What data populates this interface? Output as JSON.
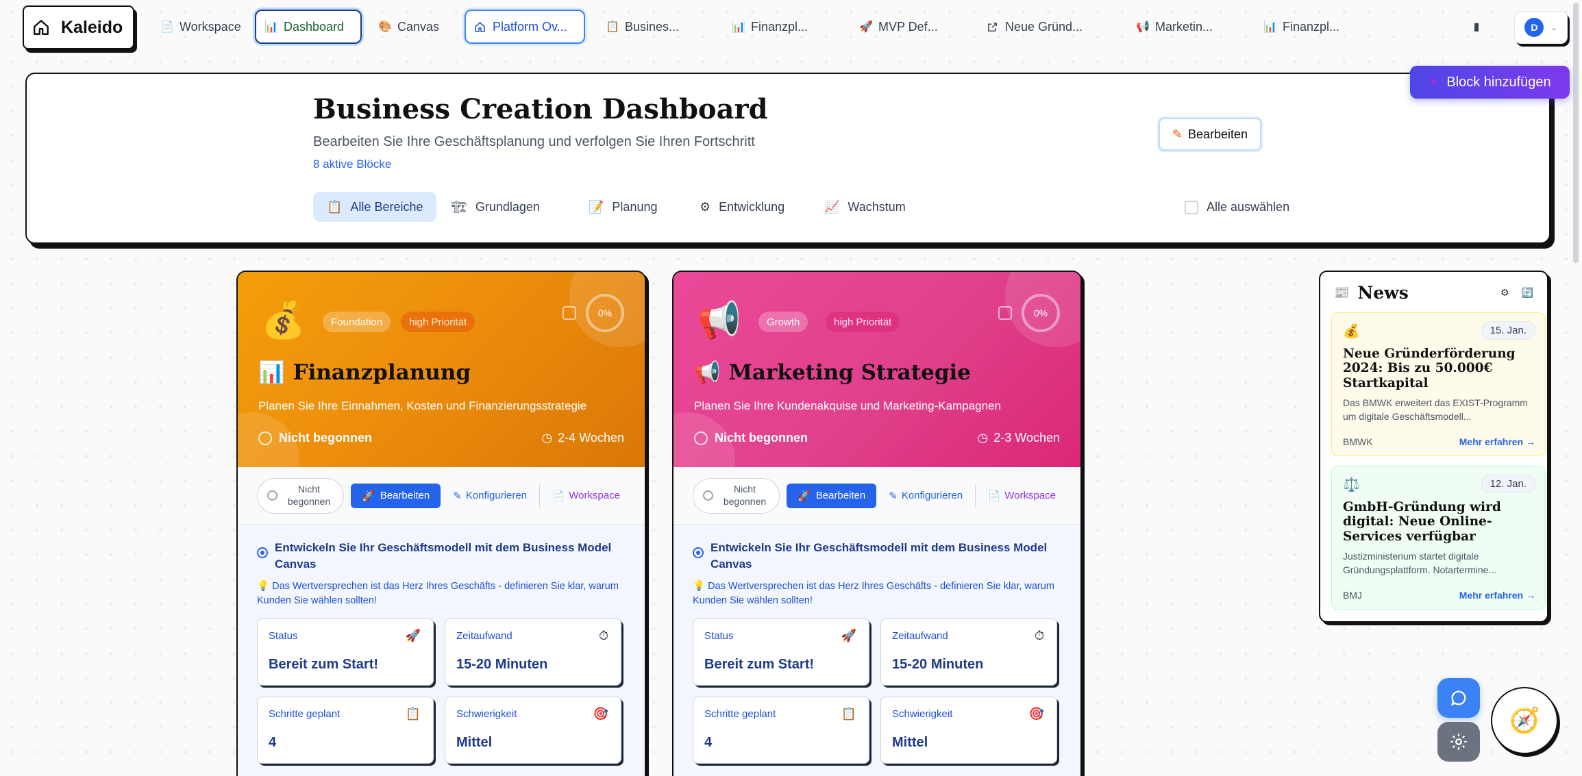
{
  "app": {
    "name": "Kaleido"
  },
  "nav": {
    "tabs": [
      {
        "label": "Workspace",
        "icon": "📄"
      },
      {
        "label": "Dashboard",
        "icon": "📊"
      },
      {
        "label": "Canvas",
        "icon": "🎨"
      },
      {
        "label": "Platform Ov...",
        "icon": "home-icon"
      },
      {
        "label": "Busines...",
        "icon": "📋"
      },
      {
        "label": "Finanzpl...",
        "icon": "📊"
      },
      {
        "label": "MVP Def...",
        "icon": "🚀"
      },
      {
        "label": "Neue Gründ...",
        "icon": "external-link-icon"
      },
      {
        "label": "Marketin...",
        "icon": "📢"
      },
      {
        "label": "Finanzpl...",
        "icon": "📊"
      }
    ],
    "user_initial": "D"
  },
  "header": {
    "title": "Business Creation Dashboard",
    "subtitle": "Bearbeiten Sie Ihre Geschäftsplanung und verfolgen Sie Ihren Fortschritt",
    "block_count": "8 aktive Blöcke",
    "edit_label": "Bearbeiten",
    "add_block_label": "Block hinzufügen",
    "select_all_label": "Alle auswählen",
    "filters": [
      {
        "label": "Alle Bereiche",
        "icon": "📋"
      },
      {
        "label": "Grundlagen",
        "icon": "🏗"
      },
      {
        "label": "Planung",
        "icon": "📝"
      },
      {
        "label": "Entwicklung",
        "icon": "⚙"
      },
      {
        "label": "Wachstum",
        "icon": "📈"
      }
    ]
  },
  "cards": [
    {
      "emoji": "💰",
      "category": "Foundation",
      "priority": "high Priorität",
      "progress": "0%",
      "title_icon": "📊",
      "title": "Finanzplanung",
      "description": "Planen Sie Ihre Einnahmen, Kosten und Finanzierungsstrategie",
      "status": "Nicht begonnen",
      "duration": "2-4 Wochen",
      "status_pill": "Nicht begonnen",
      "edit_label": "Bearbeiten",
      "configure_label": "Konfigurieren",
      "workspace_label": "Workspace",
      "bmc_title": "Entwickeln Sie Ihr Geschäftsmodell mit dem Business Model Canvas",
      "tip": "Das Wertversprechen ist das Herz Ihres Geschäfts - definieren Sie klar, warum Kunden Sie wählen sollten!",
      "stats": [
        {
          "label": "Status",
          "value": "Bereit zum Start!",
          "icon": "🚀"
        },
        {
          "label": "Zeitaufwand",
          "value": "15-20 Minuten",
          "icon": "⏱"
        },
        {
          "label": "Schritte geplant",
          "value": "4",
          "icon": "📋"
        },
        {
          "label": "Schwierigkeit",
          "value": "Mittel",
          "icon": "🎯"
        }
      ]
    },
    {
      "emoji": "📢",
      "category": "Growth",
      "priority": "high Priorität",
      "progress": "0%",
      "title_icon": "📢",
      "title": "Marketing Strategie",
      "description": "Planen Sie Ihre Kundenakquise und Marketing-Kampagnen",
      "status": "Nicht begonnen",
      "duration": "2-3 Wochen",
      "status_pill": "Nicht begonnen",
      "edit_label": "Bearbeiten",
      "configure_label": "Konfigurieren",
      "workspace_label": "Workspace",
      "bmc_title": "Entwickeln Sie Ihr Geschäftsmodell mit dem Business Model Canvas",
      "tip": "Das Wertversprechen ist das Herz Ihres Geschäfts - definieren Sie klar, warum Kunden Sie wählen sollten!",
      "stats": [
        {
          "label": "Status",
          "value": "Bereit zum Start!",
          "icon": "🚀"
        },
        {
          "label": "Zeitaufwand",
          "value": "15-20 Minuten",
          "icon": "⏱"
        },
        {
          "label": "Schritte geplant",
          "value": "4",
          "icon": "📋"
        },
        {
          "label": "Schwierigkeit",
          "value": "Mittel",
          "icon": "🎯"
        }
      ]
    }
  ],
  "news": {
    "title": "News",
    "items": [
      {
        "emoji": "💰",
        "date": "15. Jan.",
        "headline": "Neue Gründerförderung 2024: Bis zu 50.000€ Startkapital",
        "text": "Das BMWK erweitert das EXIST-Programm um digitale Geschäftsmodell...",
        "source": "BMWK",
        "more": "Mehr erfahren →"
      },
      {
        "emoji": "⚖️",
        "date": "12. Jan.",
        "headline": "GmbH-Gründung wird digital: Neue Online-Services verfügbar",
        "text": "Justizministerium startet digitale Gründungsplattform. Notartermine...",
        "source": "BMJ",
        "more": "Mehr erfahren →"
      }
    ]
  },
  "floating": {
    "compass_emoji": "🧭"
  }
}
